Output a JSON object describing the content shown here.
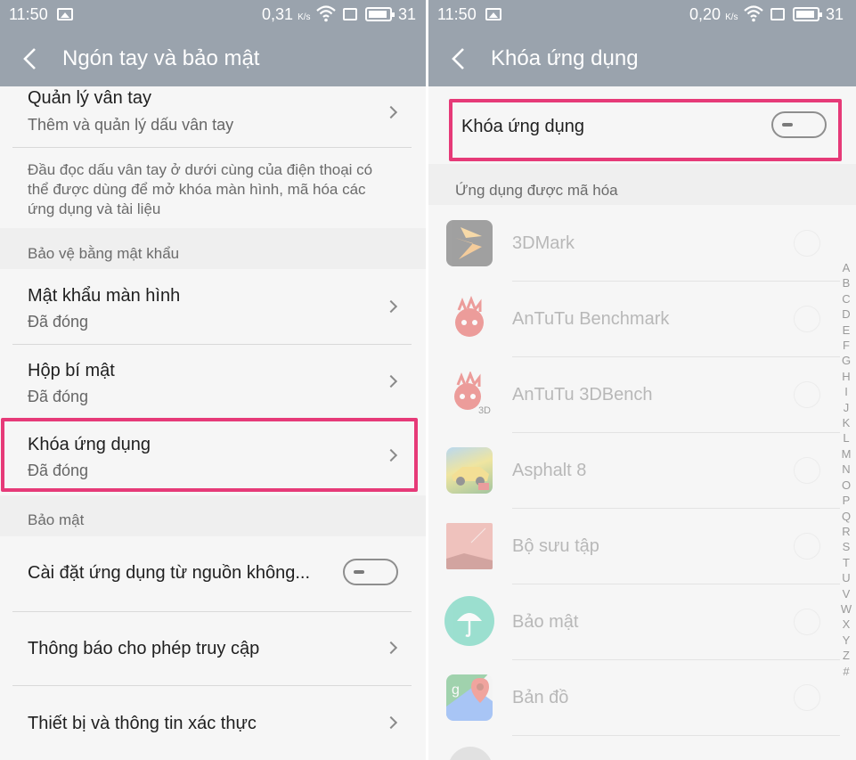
{
  "left": {
    "status": {
      "time": "11:50",
      "speed": "0,31",
      "speed_unit": "K/s",
      "battery": "31"
    },
    "title": "Ngón tay và bảo mật",
    "fingerprint": {
      "title": "Quản lý vân tay",
      "subtitle": "Thêm và quản lý dấu vân tay"
    },
    "description": [
      "Đầu đọc dấu vân tay ở dưới cùng của điện thoại có",
      "thể được dùng để mở khóa màn hình, mã hóa các",
      "ứng dụng và tài liệu"
    ],
    "section_password": "Bảo vệ bằng mật khẩu",
    "screen_password": {
      "title": "Mật khẩu màn hình",
      "subtitle": "Đã đóng"
    },
    "secret_box": {
      "title": "Hộp bí mật",
      "subtitle": "Đã đóng"
    },
    "app_lock": {
      "title": "Khóa ứng dụng",
      "subtitle": "Đã đóng"
    },
    "section_security": "Bảo mật",
    "unknown_sources": {
      "title": "Cài đặt ứng dụng từ nguồn không...",
      "enabled": false
    },
    "notification_access": "Thông báo cho phép truy cập",
    "devices_credentials": "Thiết bị và thông tin xác thực"
  },
  "right": {
    "status": {
      "time": "11:50",
      "speed": "0,20",
      "speed_unit": "K/s",
      "battery": "31"
    },
    "title": "Khóa ứng dụng",
    "toggle_label": "Khóa ứng dụng",
    "toggle_enabled": false,
    "section": "Ứng dụng được mã hóa",
    "apps": [
      {
        "name": "3DMark",
        "icon": "3dmark-icon"
      },
      {
        "name": "AnTuTu Benchmark",
        "icon": "antutu-icon"
      },
      {
        "name": "AnTuTu 3DBench",
        "icon": "antutu-3d-icon",
        "badge": "3D"
      },
      {
        "name": "Asphalt 8",
        "icon": "asphalt-icon"
      },
      {
        "name": "Bộ sưu tập",
        "icon": "gallery-icon"
      },
      {
        "name": "Bảo mật",
        "icon": "security-icon"
      },
      {
        "name": "Bản đồ",
        "icon": "maps-icon"
      }
    ],
    "index_letters": [
      "A",
      "B",
      "C",
      "D",
      "E",
      "F",
      "G",
      "H",
      "I",
      "J",
      "K",
      "L",
      "M",
      "N",
      "O",
      "P",
      "Q",
      "R",
      "S",
      "T",
      "U",
      "V",
      "W",
      "X",
      "Y",
      "Z",
      "#"
    ]
  },
  "colors": {
    "appbar": "#9aa3ad",
    "highlight": "#e63a78",
    "background": "#f6f6f6",
    "section": "#efefef"
  }
}
